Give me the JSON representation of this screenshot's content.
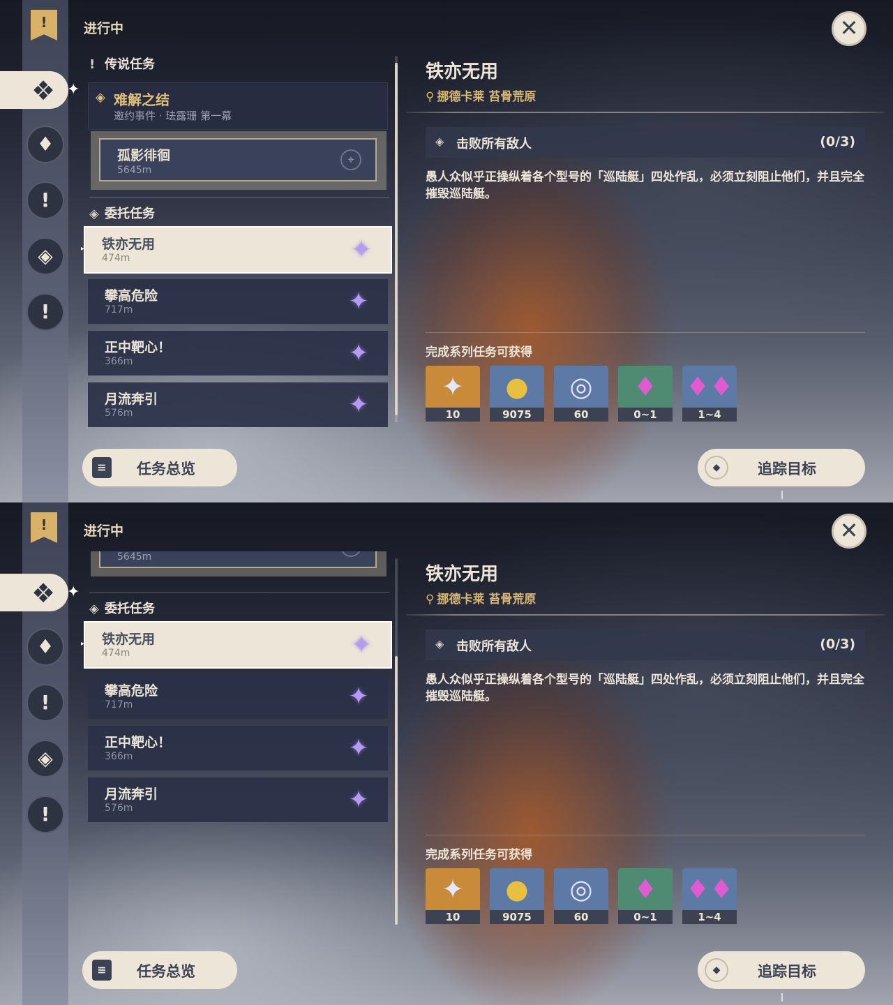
{
  "header": {
    "title": "进行中"
  },
  "sections": {
    "legend_heading": "传说任务",
    "commission_heading": "委托任务"
  },
  "legend_quest": {
    "title": "难解之结",
    "subtitle": "邀约事件 · 珐露珊 第一幕"
  },
  "sub_quest": {
    "title": "孤影徘徊",
    "distance": "5645m"
  },
  "commissions": [
    {
      "title": "铁亦无用",
      "distance": "474m"
    },
    {
      "title": "攀高危险",
      "distance": "717m"
    },
    {
      "title": "正中靶心！",
      "distance": "366m"
    },
    {
      "title": "月流奔引",
      "distance": "576m"
    }
  ],
  "detail": {
    "title": "铁亦无用",
    "location": "挪德卡莱 苔骨荒原",
    "objective": "击败所有敌人",
    "progress": "(0/3)",
    "description": "愚人众似乎正操纵着各个型号的「巡陆艇」四处作乱，必须立刻阻止他们，并且完全摧毁巡陆艇。",
    "rewards_title": "完成系列任务可获得",
    "rewards": [
      {
        "icon": "primogem-icon",
        "count": "10",
        "bg": "#c98a3a"
      },
      {
        "icon": "mora-coin-icon",
        "count": "9075",
        "bg": "#5d7aa6"
      },
      {
        "icon": "adventure-exp-icon",
        "count": "60",
        "bg": "#5d7aa6"
      },
      {
        "icon": "crystal-small-icon",
        "count": "0~1",
        "bg": "#4f8a72"
      },
      {
        "icon": "crystal-cluster-icon",
        "count": "1~4",
        "bg": "#5d7aa6"
      }
    ]
  },
  "buttons": {
    "overview": "任务总览",
    "track": "追踪目标"
  },
  "colors": {
    "accent_gold": "#d9b775",
    "panel": "#2a3146",
    "cream": "#ece5d8",
    "gem_purple": "#b59cf0"
  }
}
